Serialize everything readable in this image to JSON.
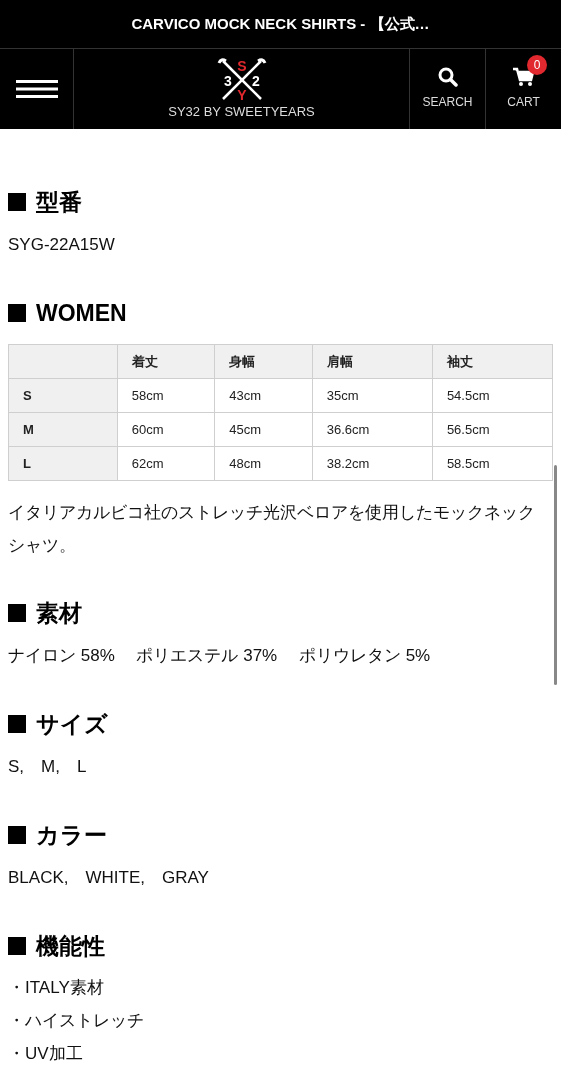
{
  "title_bar": {
    "title": "CARVICO MOCK NECK SHIRTS - 【公式…"
  },
  "nav": {
    "logo_letters": [
      "S",
      "3",
      "2",
      "Y"
    ],
    "brand": "SY32 BY SWEETYEARS",
    "search_label": "SEARCH",
    "cart_label": "CART",
    "cart_count": "0"
  },
  "sections": [
    {
      "kind": "text",
      "heading": "型番",
      "body": "SYG-22A15W"
    },
    {
      "kind": "table",
      "heading": "WOMEN",
      "columns": [
        "着丈",
        "身幅",
        "肩幅",
        "袖丈"
      ],
      "rows": [
        {
          "size": "S",
          "cells": [
            "58cm",
            "43cm",
            "35cm",
            "54.5cm"
          ]
        },
        {
          "size": "M",
          "cells": [
            "60cm",
            "45cm",
            "36.6cm",
            "56.5cm"
          ]
        },
        {
          "size": "L",
          "cells": [
            "62cm",
            "48cm",
            "38.2cm",
            "58.5cm"
          ]
        }
      ],
      "note": "イタリアカルビコ社のストレッチ光沢ベロアを使用したモックネックシャツ。"
    },
    {
      "kind": "text",
      "heading": "素材",
      "body": "ナイロン 58%　 ポリエステル 37%　 ポリウレタン 5%"
    },
    {
      "kind": "text",
      "heading": "サイズ",
      "body": "S,　M,　L"
    },
    {
      "kind": "text",
      "heading": "カラー",
      "body": "BLACK,　WHITE,　GRAY"
    },
    {
      "kind": "list",
      "heading": "機能性",
      "items": [
        "・ITALY素材",
        "・ハイストレッチ",
        "・UV加工"
      ]
    }
  ]
}
